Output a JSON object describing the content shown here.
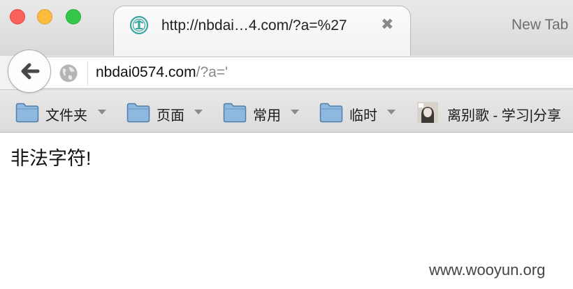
{
  "window": {
    "traffic_lights": [
      "close",
      "minimize",
      "maximize"
    ]
  },
  "tabs": {
    "active": {
      "title": "http://nbdai…4.com/?a=%27",
      "close_glyph": "✖",
      "favicon": "site-logo-icon"
    },
    "next_label": "New Tab"
  },
  "navbar": {
    "url_host": "nbdai0574.com",
    "url_path": "/?a='",
    "back_icon": "back-arrow-icon",
    "site_icon": "globe-icon"
  },
  "bookmarks": [
    {
      "label": "文件夹",
      "icon": "folder-icon",
      "dropdown": true
    },
    {
      "label": "页面",
      "icon": "folder-icon",
      "dropdown": true
    },
    {
      "label": "常用",
      "icon": "folder-icon",
      "dropdown": true
    },
    {
      "label": "临时",
      "icon": "folder-icon",
      "dropdown": true
    },
    {
      "label": "离别歌 - 学习|分享",
      "icon": "avatar-favicon",
      "dropdown": false
    }
  ],
  "page": {
    "message": "非法字符!"
  },
  "watermark": "www.wooyun.org",
  "colors": {
    "traffic_close": "#fc605b",
    "traffic_min": "#fdbc40",
    "traffic_max": "#34c84a",
    "favicon_teal": "#3aa6a0",
    "folder_blue": "#8fb8de"
  }
}
